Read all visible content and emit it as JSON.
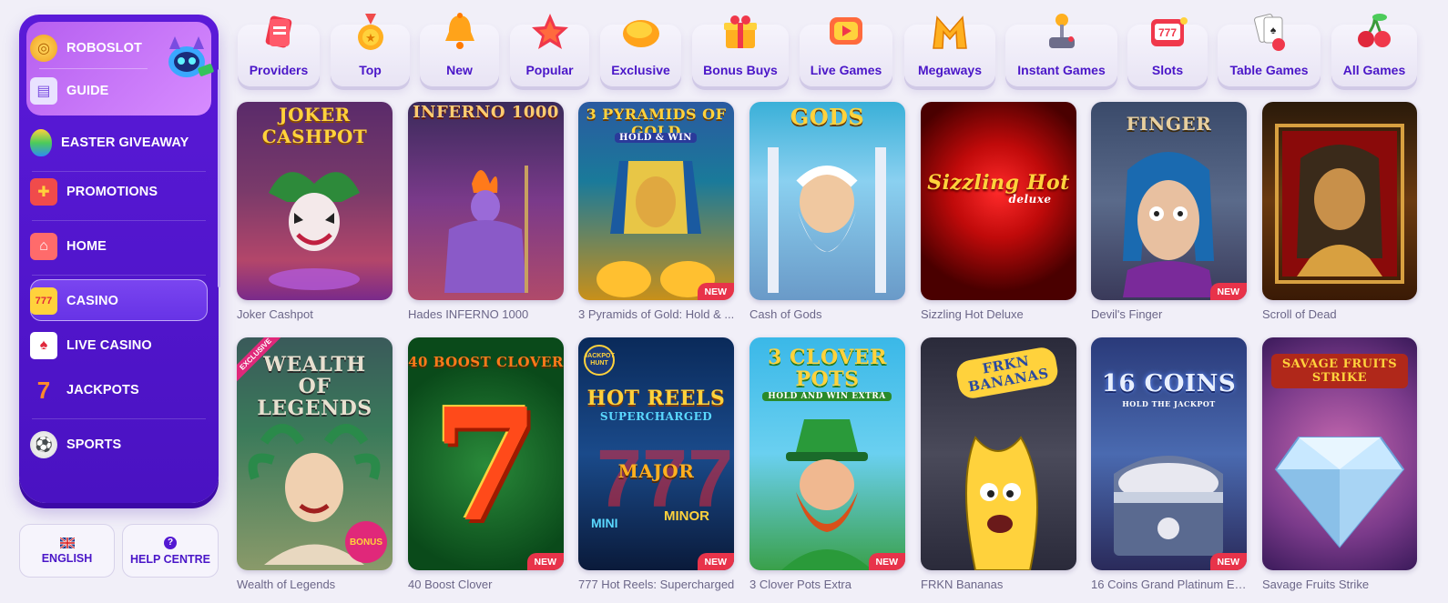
{
  "sidebar": {
    "items": [
      {
        "label": "ROBOSLOT",
        "icon": "roboslot-coin-icon"
      },
      {
        "label": "GUIDE",
        "icon": "guide-scroll-icon"
      },
      {
        "label": "EASTER GIVEAWAY",
        "icon": "easter-egg-icon"
      },
      {
        "label": "PROMOTIONS",
        "icon": "gift-icon"
      },
      {
        "label": "HOME",
        "icon": "home-icon"
      },
      {
        "label": "CASINO",
        "icon": "slot-machine-icon",
        "active": true
      },
      {
        "label": "LIVE CASINO",
        "icon": "cards-chip-icon"
      },
      {
        "label": "JACKPOTS",
        "icon": "seven-icon"
      },
      {
        "label": "SPORTS",
        "icon": "football-icon"
      }
    ],
    "language_label": "ENGLISH",
    "help_label": "HELP CENTRE",
    "help_glyph": "?"
  },
  "categories": [
    {
      "label": "Providers",
      "icon": "providers-cards-icon"
    },
    {
      "label": "Top",
      "icon": "medal-icon"
    },
    {
      "label": "New",
      "icon": "bell-icon"
    },
    {
      "label": "Popular",
      "icon": "star-fire-icon"
    },
    {
      "label": "Exclusive",
      "icon": "gem-icon"
    },
    {
      "label": "Bonus Buys",
      "icon": "gift-box-icon"
    },
    {
      "label": "Live Games",
      "icon": "play-screen-icon"
    },
    {
      "label": "Megaways",
      "icon": "megaways-m-icon"
    },
    {
      "label": "Instant Games",
      "icon": "joystick-icon"
    },
    {
      "label": "Slots",
      "icon": "slot-777-icon"
    },
    {
      "label": "Table Games",
      "icon": "playing-cards-icon"
    },
    {
      "label": "All Games",
      "icon": "cherries-icon"
    }
  ],
  "games_row1": [
    {
      "name": "Joker Cashpot",
      "art_title": "JOKER CASHPOT",
      "is_new": false
    },
    {
      "name": "Hades INFERNO 1000",
      "art_title": "INFERNO 1000",
      "is_new": false
    },
    {
      "name": "3 Pyramids of Gold: Hold & ...",
      "art_title": "3 PYRAMIDS OF GOLD",
      "art_sub": "HOLD & WIN",
      "is_new": true
    },
    {
      "name": "Cash of Gods",
      "art_title": "GODS",
      "is_new": false
    },
    {
      "name": "Sizzling Hot Deluxe",
      "art_title": "Sizzling Hot",
      "art_sub": "deluxe",
      "is_new": false
    },
    {
      "name": "Devil's Finger",
      "art_title": "FINGER",
      "is_new": true
    },
    {
      "name": "Scroll of Dead",
      "art_title": "",
      "is_new": false
    }
  ],
  "games_row2": [
    {
      "name": "Wealth of Legends",
      "art_title": "WEALTH OF LEGENDS",
      "exclusive": "EXCLUSIVE",
      "bonus": "BONUS",
      "is_new": false
    },
    {
      "name": "40 Boost Clover",
      "art_title": "40 BOOST CLOVER",
      "art_glyph": "7",
      "is_new": true
    },
    {
      "name": "777 Hot Reels: Supercharged",
      "art_title": "HOT REELS",
      "art_sub": "SUPERCHARGED",
      "art_major": "MAJOR",
      "art_mini": "MINI",
      "art_minor": "MINOR",
      "hunt": "JACKPOT HUNT",
      "is_new": true
    },
    {
      "name": "3 Clover Pots Extra",
      "art_title": "3 CLOVER POTS",
      "art_sub": "HOLD AND WIN EXTRA",
      "is_new": true
    },
    {
      "name": "FRKN Bananas",
      "art_title": "FRKN BANANAS",
      "is_new": false
    },
    {
      "name": "16 Coins Grand Platinum Edi...",
      "art_title": "16 COINS",
      "art_sub": "HOLD THE JACKPOT",
      "is_new": true
    },
    {
      "name": "Savage Fruits Strike",
      "art_title": "SAVAGE FRUITS STRIKE",
      "is_new": false
    }
  ],
  "new_badge": "NEW",
  "colors": {
    "brand": "#4a16c8",
    "sidebar": "#5a1ad8",
    "new_badge": "#e8334a"
  }
}
